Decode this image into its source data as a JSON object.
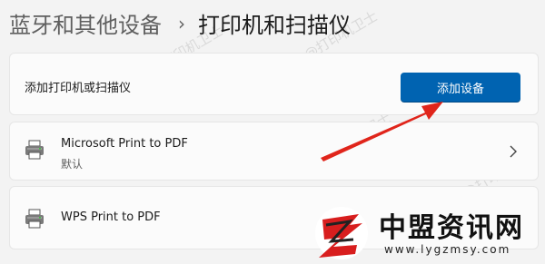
{
  "breadcrumb": {
    "parent": "蓝牙和其他设备",
    "separator": "›",
    "current": "打印机和扫描仪"
  },
  "add_section": {
    "label": "添加打印机或扫描仪",
    "button_label": "添加设备"
  },
  "printers": [
    {
      "name": "Microsoft Print to PDF",
      "status": "默认"
    },
    {
      "name": "WPS Print to PDF"
    }
  ],
  "watermark_text": "@打印机卫士",
  "brand": {
    "name": "中盟资讯网",
    "url": "www.lygzmsy.com"
  },
  "colors": {
    "accent": "#0063b1",
    "arrow": "#e0251b"
  },
  "icons": [
    "printer-icon",
    "chevron-right-icon",
    "brand-logo-icon"
  ]
}
